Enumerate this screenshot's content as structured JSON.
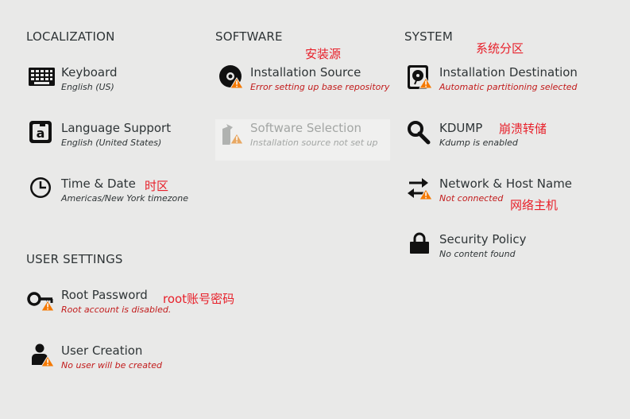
{
  "sections": {
    "localization": "LOCALIZATION",
    "software": "SOFTWARE",
    "system": "SYSTEM",
    "user_settings": "USER SETTINGS"
  },
  "spokes": {
    "keyboard": {
      "title": "Keyboard",
      "status": "English (US)"
    },
    "language": {
      "title": "Language Support",
      "status": "English (United States)"
    },
    "time": {
      "title": "Time & Date",
      "status": "Americas/New York timezone"
    },
    "install_source": {
      "title": "Installation Source",
      "status": "Error setting up base repository"
    },
    "software_selection": {
      "title": "Software Selection",
      "status": "Installation source not set up"
    },
    "install_dest": {
      "title": "Installation Destination",
      "status": "Automatic partitioning selected"
    },
    "kdump": {
      "title": "KDUMP",
      "status": "Kdump is enabled"
    },
    "network": {
      "title": "Network & Host Name",
      "status": "Not connected"
    },
    "security": {
      "title": "Security Policy",
      "status": "No content found"
    },
    "root": {
      "title": "Root Password",
      "status": "Root account is disabled."
    },
    "user": {
      "title": "User Creation",
      "status": "No user will be created"
    }
  },
  "annotations": {
    "install_source": "安装源",
    "install_dest": "系统分区",
    "kdump": "崩溃转储",
    "time": "时区",
    "network": "网络主机",
    "root": "root账号密码"
  },
  "colors": {
    "background": "#e9e9e8",
    "text": "#2e3436",
    "warning_text": "#c21b1b",
    "warning_icon": "#f57900",
    "annotation": "#e8202a",
    "disabled": "#a3a6a4"
  }
}
